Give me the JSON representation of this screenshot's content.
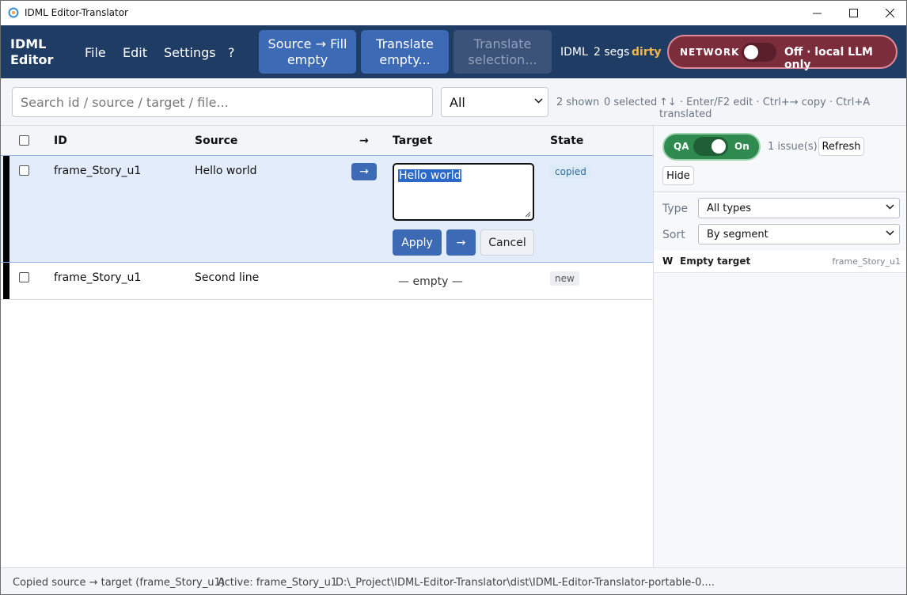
{
  "window": {
    "title": "IDML Editor-Translator",
    "controls": {
      "minimize": "—",
      "maximize": "☐",
      "close": "✕"
    }
  },
  "header": {
    "logo_line1": "IDML",
    "logo_line2": "Editor",
    "menu": {
      "file": "File",
      "edit": "Edit",
      "settings": "Settings",
      "help": "?"
    },
    "buttons": {
      "fill_line1": "Source → Fill",
      "fill_line2": "empty",
      "translate_empty_line1": "Translate",
      "translate_empty_line2": "empty...",
      "translate_selection_line1": "Translate",
      "translate_selection_line2": "selection..."
    },
    "info": {
      "format": "IDML",
      "segs": "2 segs",
      "status": "dirty"
    },
    "network": {
      "label": "NETWORK",
      "enabled": false,
      "state": "Off · local LLM only"
    }
  },
  "toolbar": {
    "search_placeholder": "Search id / source / target / file...",
    "filter_value": "All",
    "shown": "2 shown",
    "selected": "0 selected",
    "hint": "↑↓ · Enter/F2 edit · Ctrl+→ copy · Ctrl+A translated"
  },
  "table": {
    "headers": {
      "id": "ID",
      "source": "Source",
      "arrow": "→",
      "target": "Target",
      "state": "State"
    },
    "rows": [
      {
        "id": "frame_Story_u1",
        "source": "Hello world",
        "copy": "→",
        "target": "Hello world",
        "state": "copied"
      },
      {
        "id": "frame_Story_u1",
        "source": "Second line",
        "target": "— empty —",
        "state": "new"
      }
    ],
    "editor_actions": {
      "apply": "Apply",
      "copy": "→",
      "cancel": "Cancel"
    }
  },
  "qa": {
    "label": "QA",
    "enabled": true,
    "state": "On",
    "issues": "1 issue(s)",
    "refresh": "Refresh",
    "hide": "Hide",
    "type_label": "Type",
    "type_value": "All types",
    "sort_label": "Sort",
    "sort_value": "By segment",
    "items": [
      {
        "severity": "W",
        "title": "Empty target",
        "segment": "frame_Story_u1"
      }
    ]
  },
  "status": {
    "message": "Copied source → target (frame_Story_u1)",
    "active": "Active: frame_Story_u1",
    "path": "D:\\_Project\\IDML-Editor-Translator\\dist\\IDML-Editor-Translator-portable-0...."
  },
  "colors": {
    "header_bg": "#1f3d64",
    "accent": "#3d6ab5",
    "network_off": "#7b2d3c",
    "qa_on": "#2f8a50",
    "dirty": "#f3b64a",
    "active_row": "#e3ecfa"
  }
}
